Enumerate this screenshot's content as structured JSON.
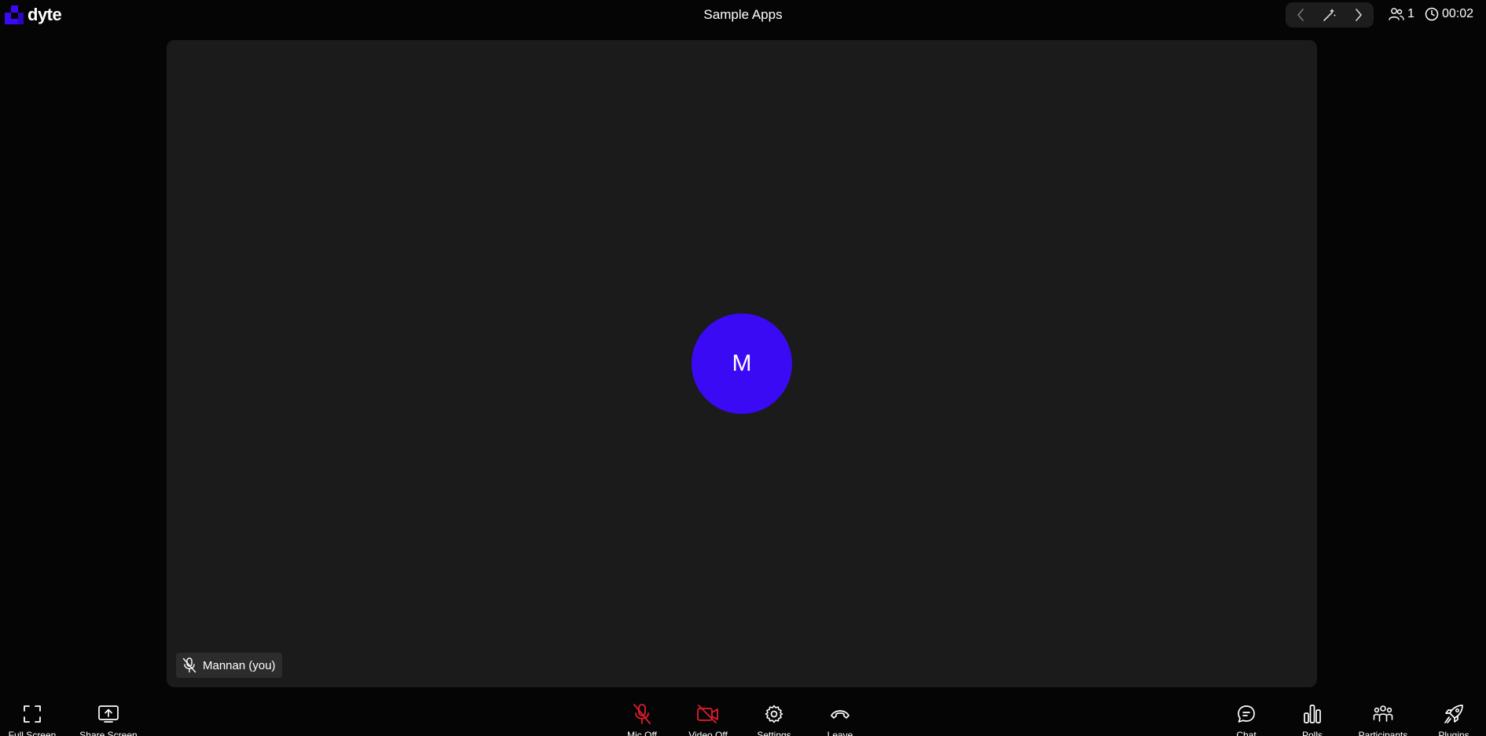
{
  "header": {
    "logo_text": "dyte",
    "meeting_title": "Sample Apps",
    "participant_count": "1",
    "elapsed_time": "00:02"
  },
  "stage": {
    "avatar_initial": "M",
    "avatar_color": "#3a0af5",
    "participant_name": "Mannan (you)"
  },
  "controls": {
    "left": [
      {
        "label": "Full Screen",
        "icon": "fullscreen-icon"
      },
      {
        "label": "Share Screen",
        "icon": "share-screen-icon"
      }
    ],
    "center": [
      {
        "label": "Mic Off",
        "icon": "mic-off-icon"
      },
      {
        "label": "Video Off",
        "icon": "video-off-icon"
      },
      {
        "label": "Settings",
        "icon": "gear-icon"
      },
      {
        "label": "Leave",
        "icon": "leave-call-icon"
      }
    ],
    "right": [
      {
        "label": "Chat",
        "icon": "chat-icon"
      },
      {
        "label": "Polls",
        "icon": "polls-icon"
      },
      {
        "label": "Participants",
        "icon": "participants-icon"
      },
      {
        "label": "Plugins",
        "icon": "rocket-icon"
      }
    ]
  },
  "colors": {
    "brand": "#3a0af5",
    "muted_red": "#e11d2d",
    "background": "#050505",
    "stage": "#1b1b1b"
  }
}
